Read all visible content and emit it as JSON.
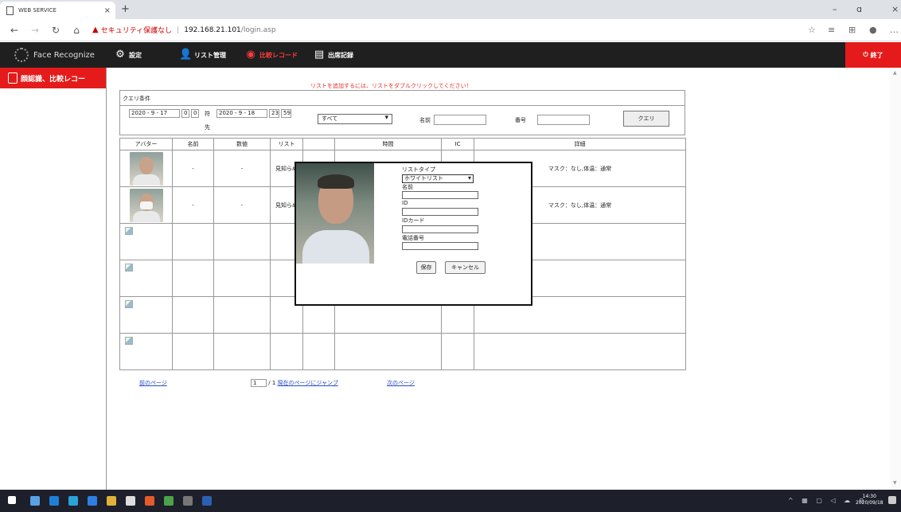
{
  "browser": {
    "tab_title": "WEB SERVICE",
    "tab_close": "×",
    "new_tab": "+",
    "security_label": "セキュリティ保護なし",
    "url_host": "192.168.21.101",
    "url_path": "/login.asp",
    "win_min": "–",
    "win_max": "ɑ",
    "win_close": "×"
  },
  "app": {
    "brand": "Face Recognize",
    "menu": {
      "settings": "設定",
      "list_mgmt": "リスト管理",
      "compare_records": "比較レコード",
      "attendance": "出席記録"
    },
    "exit": "終了",
    "left_title": "顔認識、比較レコー"
  },
  "hint": "リストを追加するには、リストをダブルクリックしてください！",
  "query": {
    "title": "クエリ条件",
    "from_date": "2020 - 9 - 17",
    "from_h": "0",
    "from_m": "0",
    "from_label": "符",
    "to_date": "2020 - 9 - 18",
    "to_h": "23",
    "to_m": "59",
    "to_label": "先",
    "type_selected": "すべて",
    "name_label": "名前",
    "number_label": "番号",
    "query_button": "クエリ"
  },
  "table": {
    "headers": [
      "アバター",
      "名前",
      "数値",
      "リスト",
      "",
      "時間",
      "IC",
      "詳細"
    ],
    "rows": [
      {
        "name": "-",
        "value": "-",
        "list": "見知らぬ",
        "detail": "マスク：なし,体温：通常"
      },
      {
        "name": "-",
        "value": "-",
        "list": "見知らぬ",
        "detail": "マスク：なし,体温：通常"
      }
    ]
  },
  "pager": {
    "prev": "前のページ",
    "page_value": "1",
    "total": "/ 1",
    "jump": "現在のページにジャンプ",
    "next": "次のページ"
  },
  "modal": {
    "list_type_label": "リストタイプ",
    "list_type_value": "ホワイトリスト",
    "name_label": "名前",
    "id_label": "ID",
    "idcard_label": "IDカード",
    "phone_label": "電話番号",
    "save": "保存",
    "cancel": "キャンセル"
  },
  "taskbar": {
    "time": "14:30",
    "date": "2020/09/18"
  },
  "colors": {
    "accent_red": "#e51b1b",
    "appbar": "#1f1f1f",
    "link_blue": "#2a4cc8"
  }
}
